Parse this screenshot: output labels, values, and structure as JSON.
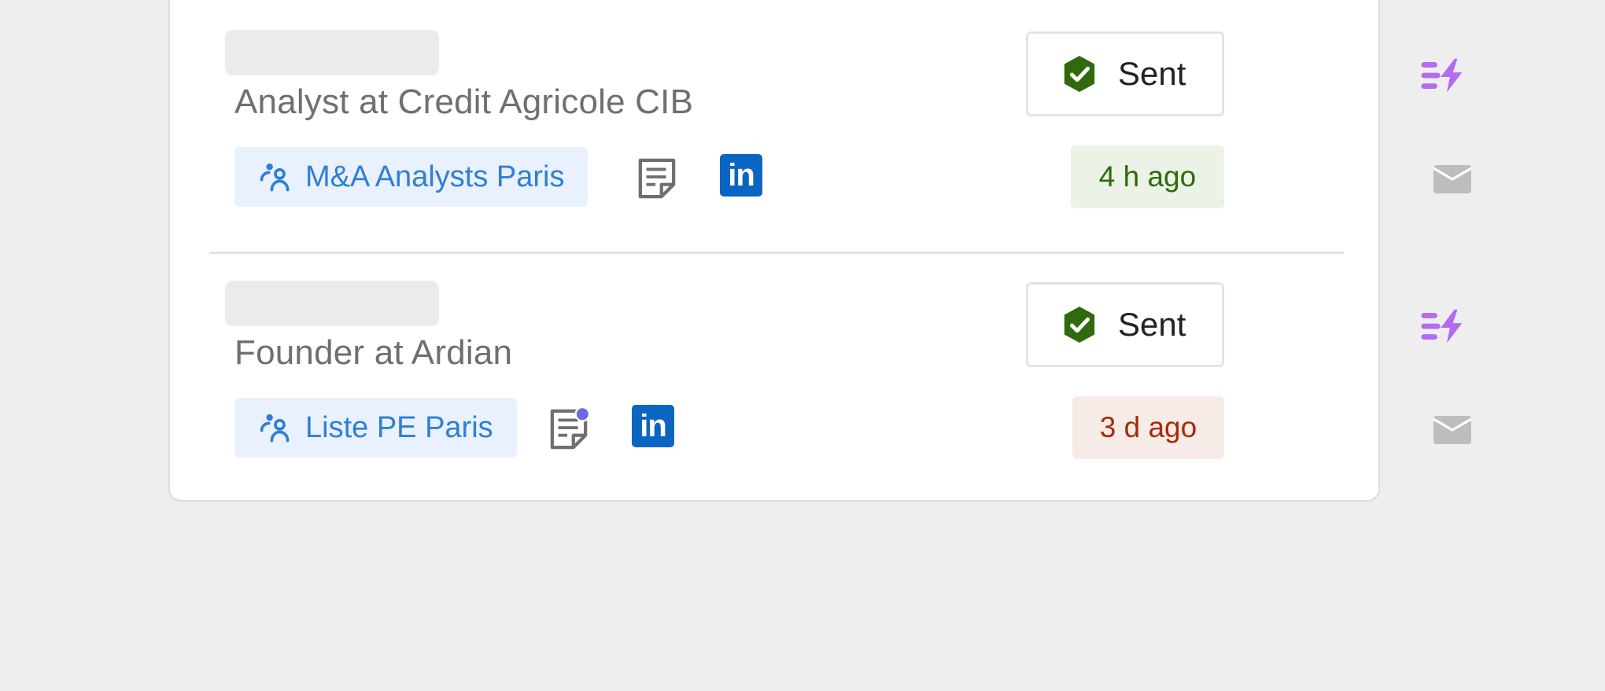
{
  "contacts": [
    {
      "title": "Analyst at Credit Agricole CIB",
      "list": "M&A Analysts Paris",
      "status": "Sent",
      "time": "4 h ago",
      "time_state": "recent",
      "has_note": false,
      "note_has_unread_dot": false
    },
    {
      "title": "Founder at Ardian",
      "list": "Liste PE Paris",
      "status": "Sent",
      "time": "3 d ago",
      "time_state": "overdue",
      "has_note": true,
      "note_has_unread_dot": true
    }
  ],
  "icons": {
    "list": "people-icon",
    "note": "note-icon",
    "linkedin": "linkedin-icon",
    "status": "check-badge-icon",
    "sequence": "flash-icon",
    "email": "mail-icon"
  },
  "linkedin_glyph": "in",
  "colors": {
    "page_bg": "#eeeeee",
    "card_bg": "#ffffff",
    "list_tag_bg": "#e8f1fd",
    "list_tag_text": "#2f7fd6",
    "linkedin_blue": "#0a66c2",
    "check_green": "#2f6a0e",
    "flash_purple": "#b46bf0",
    "time_recent_bg": "#ebf2e6",
    "time_recent_text": "#2f6a0e",
    "time_overdue_bg": "#f6ebe6",
    "time_overdue_text": "#a42c0a",
    "note_dot": "#6a6adf"
  }
}
